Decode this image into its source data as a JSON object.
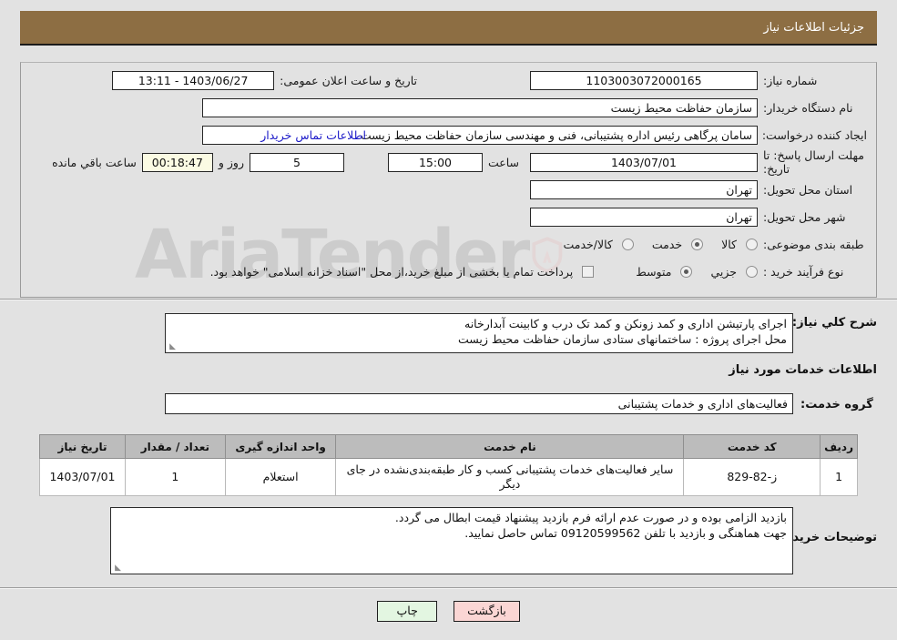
{
  "header": {
    "title": "جزئیات اطلاعات نیاز"
  },
  "info": {
    "need_number_label": "شماره نیاز:",
    "need_number_value": "1103003072000165",
    "announce_label": "تاریخ و ساعت اعلان عمومی:",
    "announce_value": "1403/06/27 - 13:11",
    "buyer_org_label": "نام دستگاه خریدار:",
    "buyer_org_value": "سازمان حفاظت محیط زیست",
    "creator_label": "ایجاد کننده درخواست:",
    "creator_value": "سامان پرگاهی رئیس اداره پشتیبانی، فنی و مهندسی سازمان حفاظت محیط زیست",
    "contact_link": "اطلاعات تماس خریدار",
    "deadline_label": "مهلت ارسال پاسخ: تا تاریخ:",
    "deadline_date": "1403/07/01",
    "deadline_hour_label": "ساعت",
    "deadline_hour": "15:00",
    "days_value": "5",
    "days_label": "روز و",
    "countdown_value": "00:18:47",
    "countdown_label": "ساعت باقي مانده",
    "province_label": "استان محل تحویل:",
    "province_value": "تهران",
    "city_label": "شهر محل تحویل:",
    "city_value": "تهران",
    "category_label": "طبقه بندی موضوعی:",
    "category_options": [
      {
        "label": "کالا",
        "selected": false
      },
      {
        "label": "خدمت",
        "selected": true
      },
      {
        "label": "کالا/خدمت",
        "selected": false
      }
    ],
    "process_label": "نوع فرآیند خرید :",
    "process_options": [
      {
        "label": "جزیي",
        "selected": false
      },
      {
        "label": "متوسط",
        "selected": true
      }
    ],
    "treasury_checkbox_label": "پرداخت تمام یا بخشی از مبلغ خرید،از محل \"اسناد خزانه اسلامی\" خواهد بود.",
    "treasury_checked": false
  },
  "description": {
    "label": "شرح کلي نیاز:",
    "line1": "اجرای پارتیشن اداری و کمد زونکن و کمد تک درب و کابینت آبدارخانه",
    "line2": "محل اجرای پروژه : ساختمانهای ستادی سازمان حفاظت محیط زیست"
  },
  "services": {
    "heading": "اطلاعات خدمات مورد نیاز",
    "group_label": "گروه خدمت:",
    "group_value": "فعالیت‌های اداری و خدمات پشتیبانی",
    "table": {
      "columns": [
        "ردیف",
        "کد خدمت",
        "نام خدمت",
        "واحد اندازه گیری",
        "تعداد / مقدار",
        "تاریخ نیاز"
      ],
      "rows": [
        {
          "row": "1",
          "code": "ز-82-829",
          "name": "سایر فعالیت‌های خدمات پشتیبانی کسب و کار طبقه‌بندی‌نشده در جای دیگر",
          "unit": "استعلام",
          "quantity": "1",
          "date": "1403/07/01"
        }
      ]
    }
  },
  "notes": {
    "label": "توضیحات خریدار:",
    "line1": "بازدید الزامی بوده و در صورت عدم ارائه فرم بازدید پیشنهاد قیمت ابطال می گردد.",
    "line2": "جهت هماهنگی و بازدید با تلفن 09120599562 تماس حاصل نمایید."
  },
  "footer": {
    "print_label": "چاپ",
    "back_label": "بازگشت"
  },
  "watermark": {
    "text": "AriaTender"
  },
  "colors": {
    "header_bar": "#8d6e43",
    "page_bg": "#e2e2e2",
    "link": "#1a18c8",
    "table_header": "#bcbcbc",
    "print_btn": "#e3f6e1",
    "back_btn": "#fbd6d4",
    "countdown_bg": "#fbfbe3"
  }
}
